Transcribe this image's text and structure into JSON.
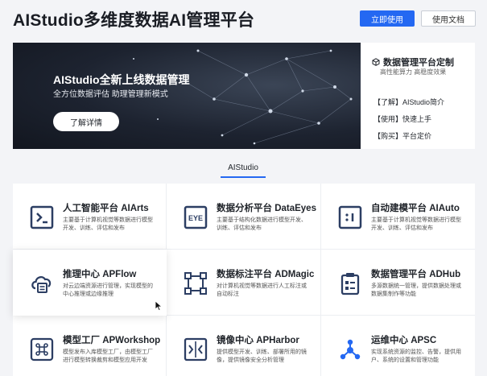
{
  "header": {
    "title": "AIStudio多维度数据AI管理平台",
    "primary_button": "立即使用",
    "secondary_button": "使用文档"
  },
  "hero": {
    "title": "AIStudio全新上线数据管理",
    "subtitle": "全方位数据评估   助理管理新模式",
    "button": "了解详情"
  },
  "side_panel": {
    "title": "数据管理平台定制",
    "subtitle": "高性能算力  高稳度效果",
    "links": [
      "【了解】AIStudio简介",
      "【使用】快速上手",
      "【购买】平台定价"
    ]
  },
  "section": {
    "tab": "AIStudio"
  },
  "products": [
    {
      "title": "人工智能平台 AIArts",
      "desc": "主要基于计算机视觉等数据进行模型开发、训练、评估和发布",
      "icon": "terminal-icon"
    },
    {
      "title": "数据分析平台 DataEyes",
      "desc": "主要基于结构化数据进行模型开发、训练、评估和发布",
      "icon": "eye-icon"
    },
    {
      "title": "自动建模平台 AIAuto",
      "desc": "主要基于计算机视觉等数据进行模型开发、训练、评估和发布",
      "icon": "auto-model-icon"
    },
    {
      "title": "推理中心 APFlow",
      "desc": "对云边端资源进行管理，实现模型的中心推理或边缘推理",
      "icon": "cloud-inference-icon"
    },
    {
      "title": "数据标注平台 ADMagic",
      "desc": "对计算机视觉等数据进行人工标注或自动标注",
      "icon": "annotation-icon"
    },
    {
      "title": "数据管理平台 ADHub",
      "desc": "多源数据统一管理，提供数据处理或数据集制作等功能",
      "icon": "clipboard-icon"
    },
    {
      "title": "模型工厂 APWorkshop",
      "desc": "模型发布入库模型工厂，由模型工厂进行模型转换裁剪和模型应用开发",
      "icon": "command-icon"
    },
    {
      "title": "镜像中心 APHarbor",
      "desc": "提供模型开发、训练、部署所用的镜像，提供镜像安全分析管理",
      "icon": "mirror-icon"
    },
    {
      "title": "运维中心 APSC",
      "desc": "实现系统资源的监控、告警，提供用户、系统的设置和管理功能",
      "icon": "network-icon"
    }
  ],
  "colors": {
    "accent": "#2468f2",
    "icon_dark": "#2c3e63",
    "hero_bg": "#1d2330"
  }
}
